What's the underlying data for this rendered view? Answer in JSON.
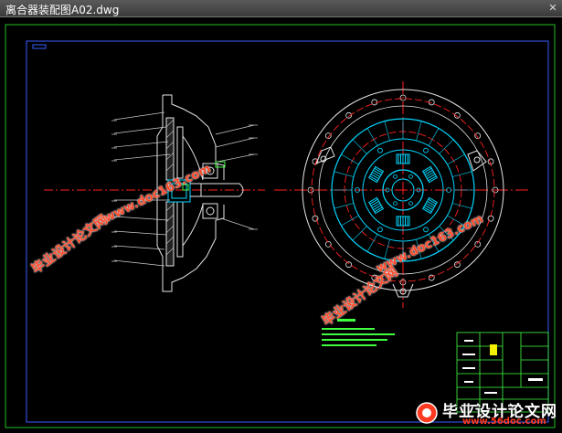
{
  "window": {
    "title": "离合器装配图A02.dwg",
    "close_glyph": "✕"
  },
  "watermarks": {
    "site_name": "毕业设计论文网",
    "site_url": "www.doc163.com"
  },
  "brand": {
    "name": "毕业设计论文网",
    "url": "www.56doc.com"
  },
  "colors": {
    "background": "#000000",
    "frame_green": "#22c022",
    "frame_blue": "#3a5cff",
    "section_white": "#e6e6e6",
    "cyan": "#00d8ff",
    "red": "#ff2020",
    "watermark": "#ff4a2a",
    "table_green": "#40ff40"
  }
}
